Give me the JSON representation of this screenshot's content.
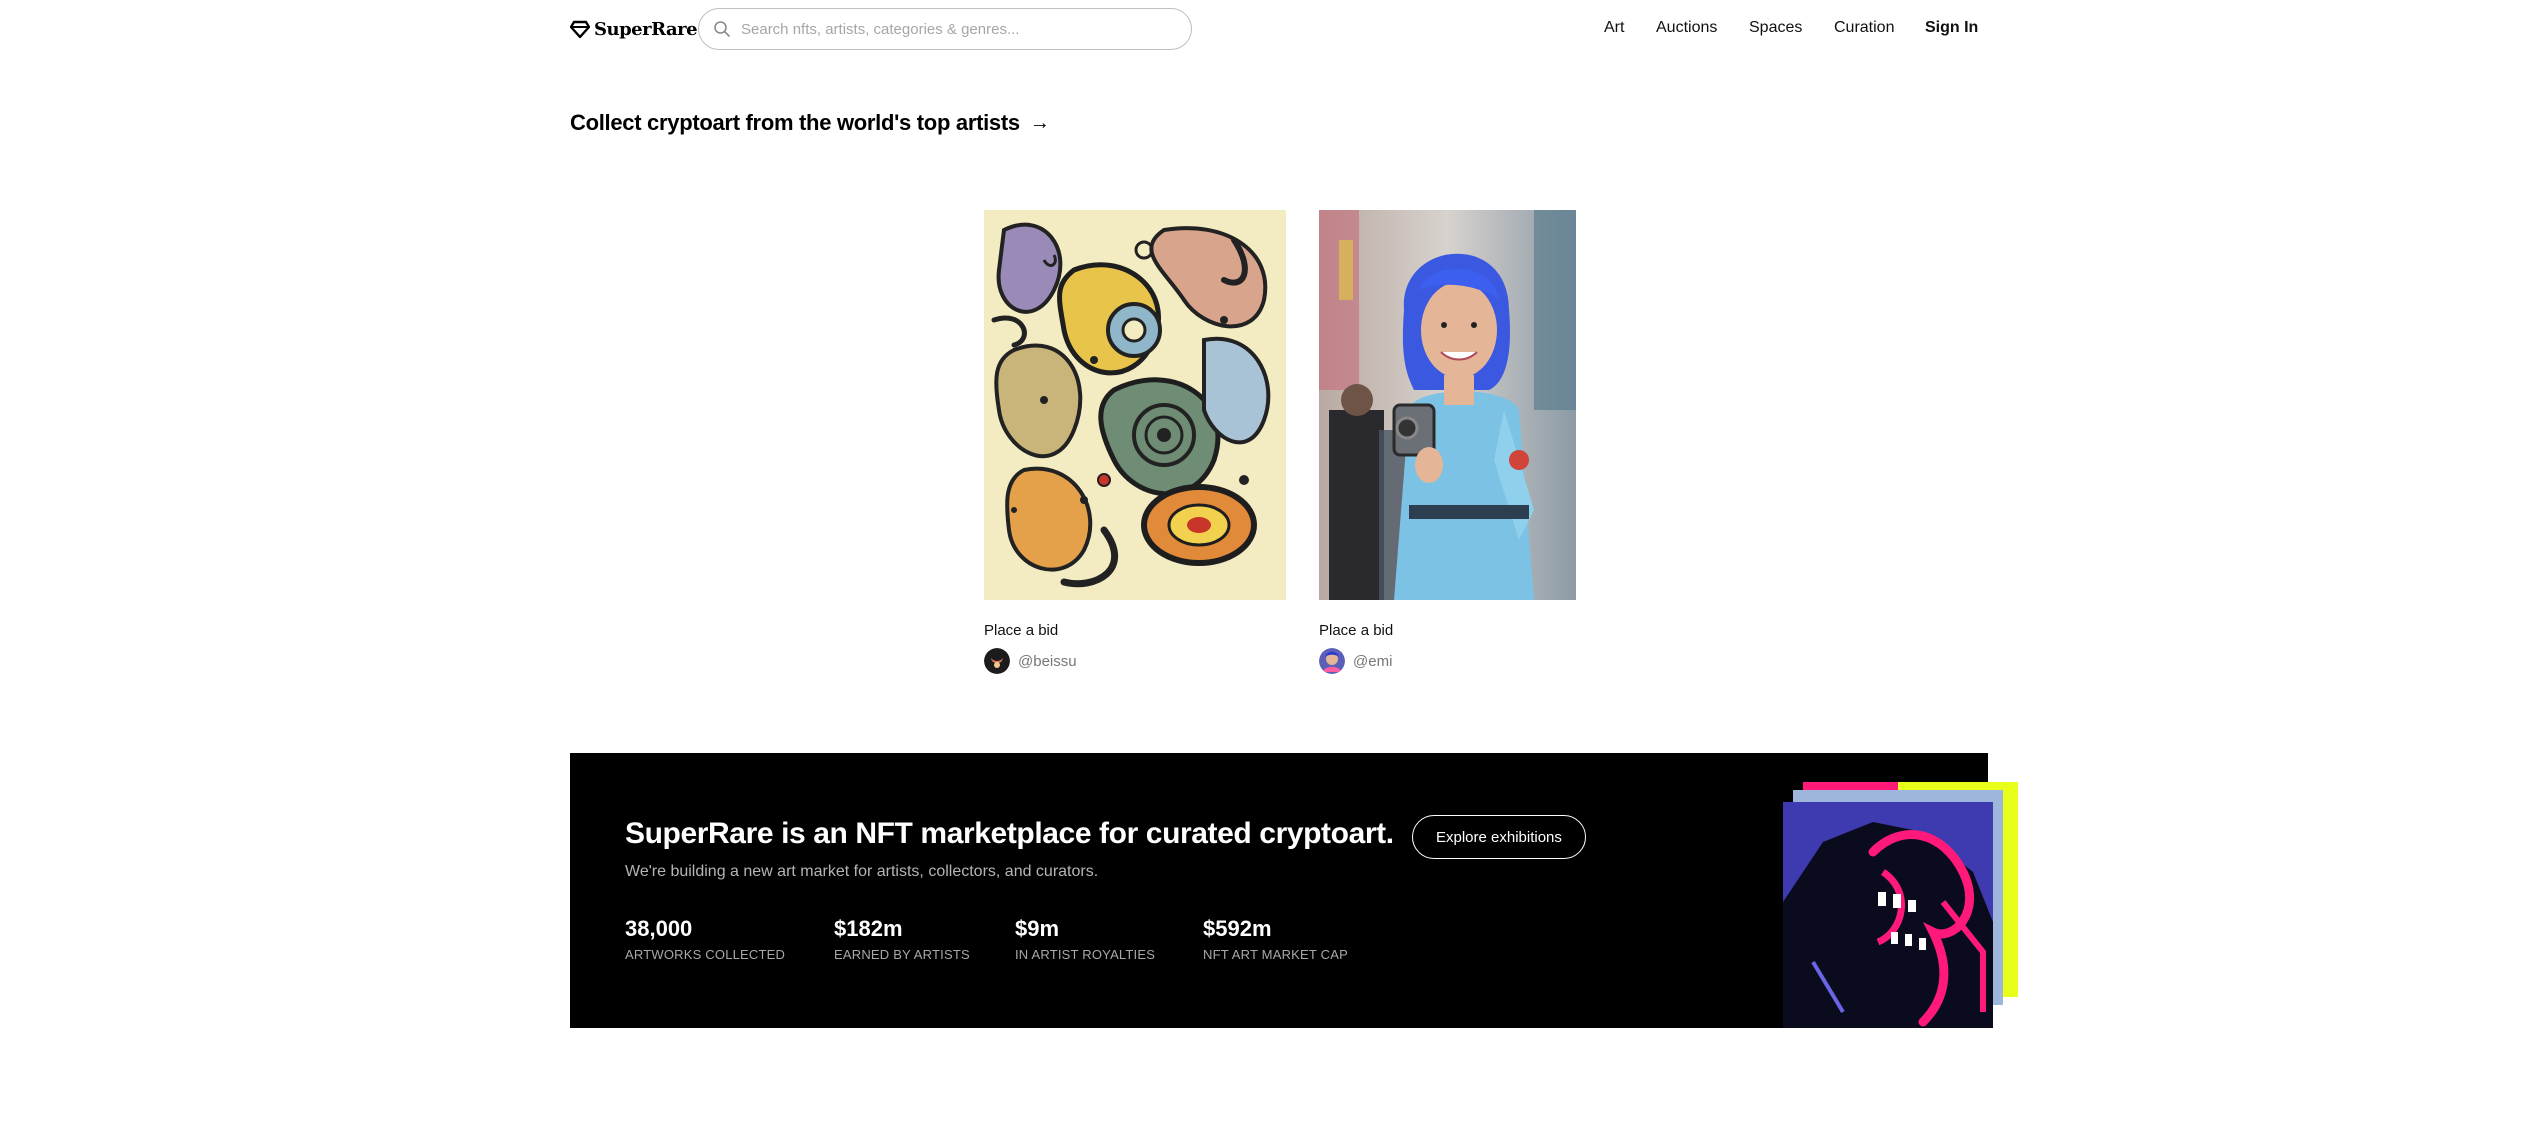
{
  "header": {
    "logo_text": "SuperRare",
    "search_placeholder": "Search nfts, artists, categories & genres...",
    "nav": [
      "Art",
      "Auctions",
      "Spaces",
      "Curation",
      "Sign In"
    ]
  },
  "heading": {
    "text": "Collect cryptoart from the world's top artists",
    "arrow": "→"
  },
  "artworks": [
    {
      "action": "Place a bid",
      "handle": "@beissu"
    },
    {
      "action": "Place a bid",
      "handle": "@emi"
    }
  ],
  "banner": {
    "title": "SuperRare is an NFT marketplace for curated cryptoart.",
    "subtitle": "We're building a new art market for artists, collectors, and curators.",
    "cta": "Explore exhibitions",
    "stats": [
      {
        "value": "38,000",
        "label": "ARTWORKS COLLECTED"
      },
      {
        "value": "$182m",
        "label": "EARNED BY ARTISTS"
      },
      {
        "value": "$9m",
        "label": "IN ARTIST ROYALTIES"
      },
      {
        "value": "$592m",
        "label": "NFT ART MARKET CAP"
      }
    ]
  },
  "colors": {
    "banner_bg": "#000000",
    "accent_pink": "#ff1a7a",
    "accent_yellow": "#e8ff1a"
  }
}
